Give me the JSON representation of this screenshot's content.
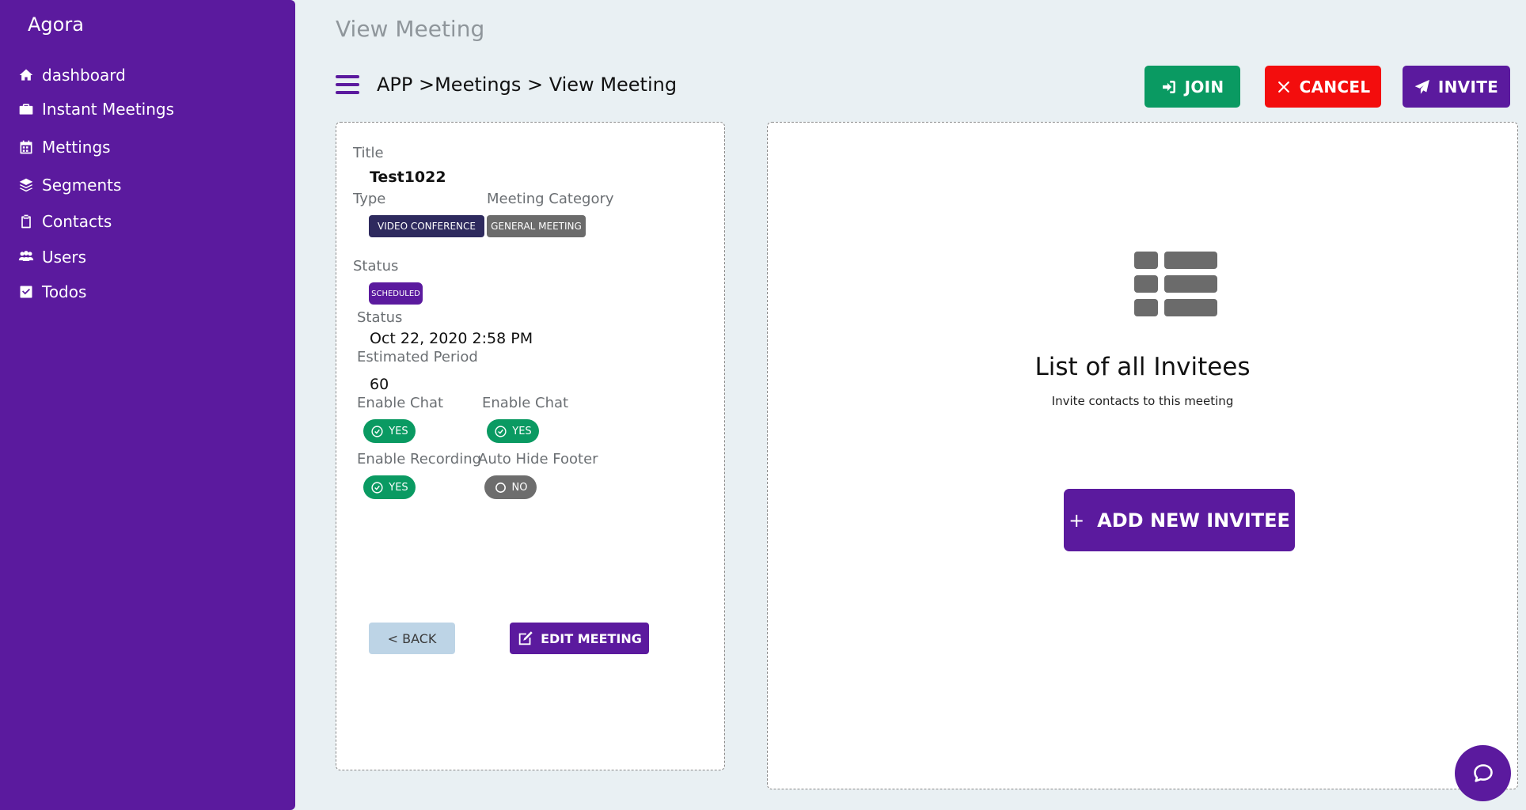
{
  "app": {
    "name": "Agora"
  },
  "sidebar": {
    "items": [
      {
        "label": "dashboard",
        "icon": "home-icon"
      },
      {
        "label": "Instant Meetings",
        "icon": "briefcase-icon"
      },
      {
        "label": "Mettings",
        "icon": "calendar-icon"
      },
      {
        "label": "Segments",
        "icon": "layers-icon"
      },
      {
        "label": "Contacts",
        "icon": "clipboard-icon"
      },
      {
        "label": "Users",
        "icon": "users-icon"
      },
      {
        "label": "Todos",
        "icon": "checkbox-icon"
      }
    ]
  },
  "header": {
    "page_title": "View Meeting",
    "breadcrumb": "APP >Meetings > View Meeting",
    "join_label": "JOIN",
    "cancel_label": "CANCEL",
    "invite_label": "INVITE"
  },
  "details": {
    "title_label": "Title",
    "title_value": "Test1022",
    "type_label": "Type",
    "type_value": "VIDEO CONFERENCE",
    "category_label": "Meeting Category",
    "category_value": "GENERAL MEETING",
    "status_label": "Status",
    "status_value": "SCHEDULED",
    "status2_label": "Status",
    "status2_value": "Oct 22, 2020 2:58 PM",
    "period_label": "Estimated Period",
    "period_value": "60",
    "chat_label": "Enable Chat",
    "chat_value": "YES",
    "chat2_label": "Enable Chat",
    "chat2_value": "YES",
    "recording_label": "Enable Recording",
    "recording_value": "YES",
    "footer_label": "Auto Hide Footer",
    "footer_value": "NO",
    "back_label": "< BACK",
    "edit_label": "EDIT MEETING"
  },
  "invitees": {
    "title": "List of all Invitees",
    "subtitle": "Invite contacts to this meeting",
    "add_label": "ADD NEW INVITEE",
    "add_prefix": "+"
  },
  "colors": {
    "primary": "#5b1a9e",
    "join": "#0a9a62",
    "cancel": "#f30d0d",
    "type_badge": "#2e2a5e",
    "category_badge": "#6b6b6b",
    "yes_pill": "#0a9a62",
    "no_pill": "#6d6d6d",
    "back_button": "#bdd4e6"
  }
}
